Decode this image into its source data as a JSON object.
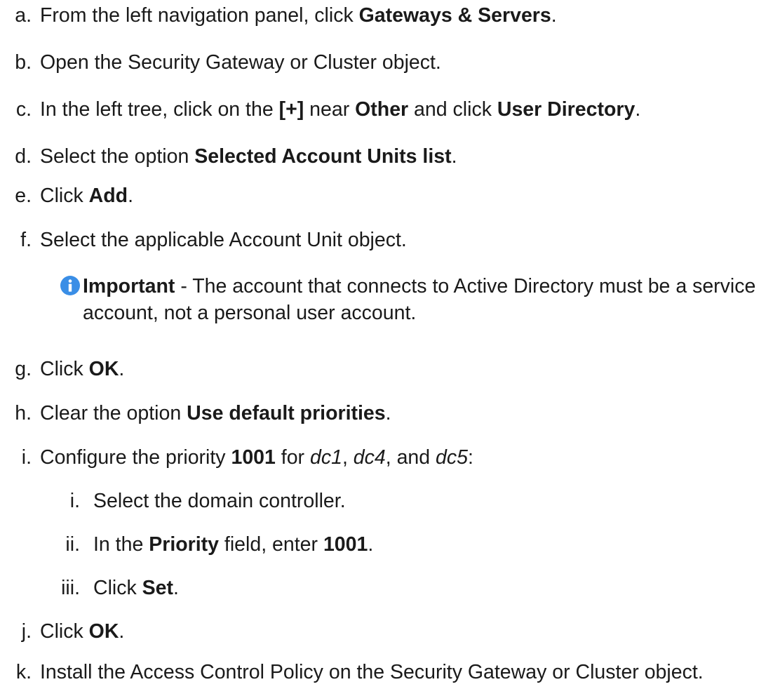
{
  "steps": [
    {
      "marker": "a.",
      "parts": [
        "From the left navigation panel, click ",
        "Gateways & Servers",
        "."
      ]
    },
    {
      "marker": "b.",
      "parts": [
        "Open the Security Gateway or Cluster object."
      ]
    },
    {
      "marker": "c.",
      "parts": [
        "In the left tree, click on the ",
        "[+]",
        " near ",
        "Other",
        " and click ",
        "User Directory",
        "."
      ]
    },
    {
      "marker": "d.",
      "parts": [
        "Select the option ",
        "Selected Account Units list",
        "."
      ]
    },
    {
      "marker": "e.",
      "parts": [
        "Click ",
        "Add",
        "."
      ]
    },
    {
      "marker": "f.",
      "parts": [
        "Select the applicable Account Unit object."
      ]
    },
    {
      "marker": "g.",
      "parts": [
        "Click ",
        "OK",
        "."
      ]
    },
    {
      "marker": "h.",
      "parts": [
        "Clear the option ",
        "Use default priorities",
        "."
      ]
    },
    {
      "marker": "i.",
      "parts": [
        "Configure the priority ",
        "1001",
        " for ",
        "dc1",
        ", ",
        "dc4",
        ", and ",
        "dc5",
        ":"
      ]
    },
    {
      "marker": "j.",
      "parts": [
        "Click ",
        "OK",
        "."
      ]
    },
    {
      "marker": "k.",
      "parts": [
        "Install the Access Control Policy on the Security Gateway or Cluster object."
      ]
    }
  ],
  "substeps": [
    {
      "marker": "i.",
      "parts": [
        "Select the domain controller."
      ]
    },
    {
      "marker": "ii.",
      "parts": [
        "In the ",
        "Priority",
        " field, enter ",
        "1001",
        "."
      ]
    },
    {
      "marker": "iii.",
      "parts": [
        "Click ",
        "Set",
        "."
      ]
    }
  ],
  "note": {
    "icon": "info-icon",
    "icon_color": "#3a8ee6",
    "label": "Important",
    "text": " - The account that connects to Active Directory must be a service account, not a personal user account."
  }
}
